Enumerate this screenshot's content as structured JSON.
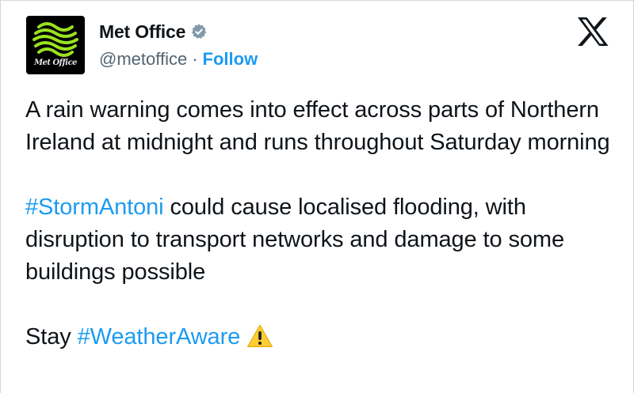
{
  "account": {
    "display_name": "Met Office",
    "handle": "@metoffice",
    "separator": "·",
    "follow_label": "Follow",
    "avatar_text": "Met Office",
    "verified_color": "#829aab"
  },
  "post": {
    "paragraph1": "A rain warning comes into effect across parts of Northern Ireland at midnight and runs throughout Saturday morning",
    "paragraph2_hashtag": "#StormAntoni",
    "paragraph2_rest": " could cause localised flooding, with disruption to transport networks and damage to some buildings possible",
    "paragraph3_prefix": "Stay ",
    "paragraph3_hashtag": "#WeatherAware",
    "warning_emoji": "warning-sign"
  },
  "colors": {
    "text": "#0f1419",
    "secondary": "#536471",
    "link": "#1d9bf0",
    "warning_yellow": "#ffcc32"
  },
  "icons": [
    "x-logo-icon",
    "verified-badge-icon",
    "met-office-logo",
    "warning-icon"
  ]
}
